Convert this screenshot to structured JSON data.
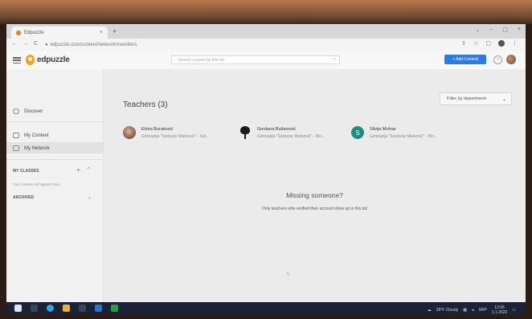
{
  "browser": {
    "tab_title": "Edpuzzle",
    "tab_close": "×",
    "new_tab": "+",
    "url": "edpuzzle.com/content/network/members",
    "window_buttons": [
      "⌄",
      "–",
      "▢",
      "×"
    ],
    "nav": [
      "←",
      "→",
      "C"
    ]
  },
  "header": {
    "logo_text": "edpuzzle",
    "search_placeholder": "Search a panel by title etc",
    "add_content_label": "+ Add Content",
    "help_label": "?"
  },
  "sidebar": {
    "discover": "Discover",
    "my_content": "My Content",
    "my_network": "My Network",
    "my_classes": "MY CLASSES",
    "add": "+",
    "collapse": "^",
    "classes_placeholder": "Your classes will appear here",
    "archived": "ARCHIVED",
    "expand": "⌄"
  },
  "main": {
    "title": "Teachers (3)",
    "filter_label": "Filter by department",
    "filter_chevron": "⌄",
    "teachers": [
      {
        "name": "Elvira Buraković",
        "school": "Gimnazija \"Svetozar Marković\" - Sol..."
      },
      {
        "name": "Gordana Bušanović",
        "school": "Gimnazija \"Svetozar Marković\" - Wo..."
      },
      {
        "name": "Silvija Molnar",
        "school": "Gimnazija \"Svetozar Marković\" - Wo...",
        "initial": "S"
      }
    ],
    "missing_title": "Missing someone?",
    "missing_sub": "Only teachers who verified their account show up in this list"
  },
  "taskbar": {
    "weather": "39°F Cloudy",
    "language": "SRP",
    "time": "13:06",
    "date": "1.1.2022"
  },
  "colors": {
    "accent": "#2c7be5",
    "logo": "#f0a21f",
    "avatar_s": "#1f8c7f"
  }
}
